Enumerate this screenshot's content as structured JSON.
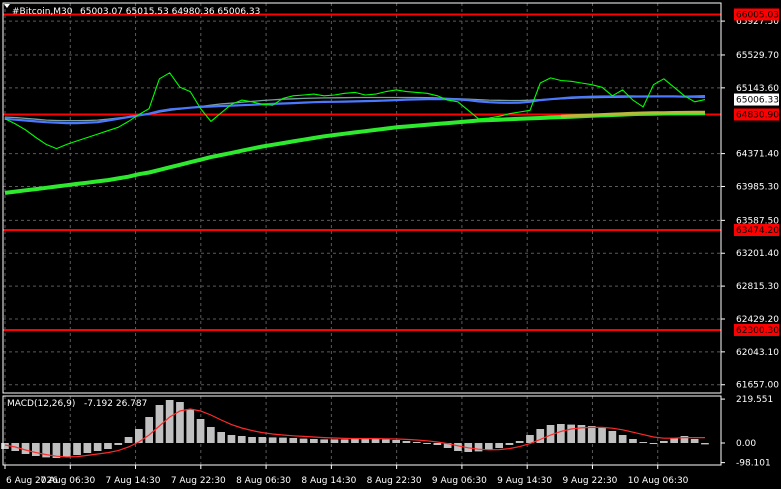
{
  "header": {
    "symbol_label": "#Bitcoin,M30",
    "quote": "65003.07 65015.53 64980.36 65006.33"
  },
  "macd": {
    "label": "MACD(12,26,9)",
    "values": "-7.192 26.787",
    "axis_ticks": [
      "219.551",
      "0.00",
      "-98.101"
    ]
  },
  "colors": {
    "background": "#000000",
    "grid": "#5a5a5a",
    "price": "#00ff00",
    "ma_fast": "#4a78ff",
    "ma_mid": "#7a9fa0",
    "ma_slow": "#2eea2e",
    "ma_olive": "#b8b83a",
    "level_line": "#ff0000",
    "histogram": "#c0c0c0",
    "signal": "#ff2a2a"
  },
  "chart_data": [
    {
      "type": "line",
      "title": "#Bitcoin,M30",
      "ylim": [
        61560,
        66140
      ],
      "y_ticks": [
        "65927.50",
        "65529.70",
        "65143.60",
        "64371.40",
        "63985.30",
        "63587.50",
        "63201.40",
        "62815.30",
        "62429.20",
        "62043.10",
        "61657.00"
      ],
      "x_ticks": [
        "6 Aug 2026",
        "7 Aug 06:30",
        "7 Aug 14:30",
        "7 Aug 22:30",
        "8 Aug 06:30",
        "8 Aug 14:30",
        "8 Aug 22:30",
        "9 Aug 06:30",
        "9 Aug 14:30",
        "9 Aug 22:30",
        "10 Aug 06:30"
      ],
      "last_price": "65006.33",
      "levels": [
        {
          "label": "66005.03",
          "value": 66005.03
        },
        {
          "label": "64830.90",
          "value": 64830.9
        },
        {
          "label": "63474.20",
          "value": 63474.2
        },
        {
          "label": "62300.30",
          "value": 62300.3
        }
      ],
      "series": [
        {
          "key": "price",
          "values": [
            64780,
            64720,
            64650,
            64560,
            64480,
            64430,
            64480,
            64520,
            64560,
            64600,
            64640,
            64680,
            64750,
            64830,
            64900,
            65250,
            65320,
            65150,
            65100,
            64900,
            64750,
            64850,
            64950,
            65000,
            64980,
            64950,
            64940,
            65020,
            65050,
            65060,
            65070,
            65050,
            65060,
            65080,
            65090,
            65060,
            65070,
            65100,
            65120,
            65100,
            65090,
            65080,
            65050,
            65000,
            64980,
            64880,
            64780,
            64790,
            64810,
            64840,
            64860,
            64880,
            65200,
            65260,
            65230,
            65220,
            65200,
            65180,
            65150,
            65050,
            65120,
            65000,
            64920,
            65180,
            65250,
            65150,
            65050,
            64980,
            65006
          ]
        },
        {
          "key": "ma_fast",
          "values": [
            64780,
            64770,
            64760,
            64750,
            64740,
            64735,
            64730,
            64730,
            64735,
            64740,
            64760,
            64780,
            64800,
            64820,
            64840,
            64870,
            64890,
            64900,
            64910,
            64920,
            64925,
            64930,
            64935,
            64940,
            64945,
            64950,
            64955,
            64960,
            64965,
            64970,
            64975,
            64978,
            64980,
            64982,
            64985,
            64988,
            64990,
            64995,
            65000,
            65005,
            65008,
            65010,
            65012,
            65010,
            65008,
            65000,
            64985,
            64975,
            64970,
            64968,
            64970,
            64980,
            65000,
            65010,
            65020,
            65030,
            65035,
            65040,
            65042,
            65042,
            65043,
            65043,
            65042,
            65043,
            65043,
            65043,
            65040,
            65038,
            65036
          ]
        },
        {
          "key": "ma_mid",
          "values": [
            64800,
            64795,
            64785,
            64775,
            64765,
            64760,
            64758,
            64758,
            64760,
            64765,
            64775,
            64790,
            64805,
            64820,
            64835,
            64860,
            64880,
            64895,
            64910,
            64925,
            64940,
            64955,
            64965,
            64975,
            64985,
            64995,
            65002,
            65010,
            65015,
            65020,
            65023,
            65025,
            65027,
            65028,
            65030,
            65030,
            65030,
            65030,
            65030,
            65030,
            65030,
            65028,
            65025,
            65020,
            65015,
            65010,
            65005,
            65000,
            64997,
            64995,
            64995,
            64998,
            65005,
            65010,
            65015,
            65020,
            65025,
            65028,
            65030,
            65032,
            65034,
            65036,
            65038,
            65040,
            65042,
            65044,
            65046,
            65048,
            65050
          ]
        },
        {
          "key": "ma_slow",
          "values": [
            63910,
            63925,
            63940,
            63955,
            63970,
            63985,
            64000,
            64015,
            64030,
            64045,
            64060,
            64080,
            64100,
            64130,
            64150,
            64180,
            64210,
            64240,
            64270,
            64300,
            64330,
            64355,
            64380,
            64405,
            64430,
            64455,
            64475,
            64495,
            64515,
            64535,
            64555,
            64575,
            64590,
            64605,
            64620,
            64635,
            64650,
            64665,
            64680,
            64690,
            64700,
            64710,
            64720,
            64730,
            64740,
            64750,
            64760,
            64765,
            64770,
            64775,
            64780,
            64785,
            64790,
            64795,
            64800,
            64805,
            64810,
            64815,
            64820,
            64825,
            64830,
            64835,
            64838,
            64840,
            64842,
            64844,
            64845,
            64846,
            64848
          ]
        },
        {
          "key": "ma_olive",
          "values": [
            null,
            null,
            null,
            null,
            null,
            null,
            null,
            null,
            null,
            null,
            null,
            null,
            null,
            null,
            null,
            null,
            null,
            null,
            null,
            null,
            null,
            null,
            null,
            null,
            null,
            null,
            null,
            null,
            null,
            null,
            null,
            null,
            null,
            null,
            null,
            null,
            null,
            null,
            null,
            null,
            null,
            null,
            null,
            null,
            null,
            null,
            null,
            null,
            null,
            null,
            null,
            null,
            null,
            null,
            64810,
            64815,
            64820,
            64825,
            64830,
            64835,
            64840,
            64845,
            64848,
            64850,
            64852,
            64854,
            64855,
            64856,
            64857
          ]
        }
      ]
    },
    {
      "type": "bar",
      "title": "MACD(12,26,9)",
      "ylim": [
        -110,
        235
      ],
      "histogram": [
        -30,
        -40,
        -55,
        -65,
        -72,
        -75,
        -70,
        -60,
        -50,
        -40,
        -30,
        -10,
        30,
        70,
        130,
        190,
        215,
        205,
        170,
        120,
        80,
        55,
        40,
        35,
        30,
        30,
        28,
        27,
        25,
        22,
        20,
        18,
        18,
        18,
        20,
        22,
        20,
        18,
        15,
        10,
        5,
        0,
        -10,
        -25,
        -40,
        -45,
        -42,
        -35,
        -25,
        -10,
        10,
        40,
        70,
        90,
        95,
        92,
        90,
        85,
        75,
        60,
        40,
        20,
        5,
        0,
        10,
        25,
        35,
        20,
        -7
      ],
      "signal": [
        -10,
        -20,
        -35,
        -48,
        -58,
        -66,
        -70,
        -68,
        -62,
        -55,
        -48,
        -38,
        -20,
        5,
        40,
        85,
        130,
        160,
        170,
        160,
        140,
        115,
        92,
        75,
        62,
        52,
        45,
        40,
        36,
        33,
        30,
        27,
        25,
        23,
        22,
        22,
        22,
        21,
        20,
        18,
        15,
        11,
        5,
        -3,
        -14,
        -24,
        -31,
        -34,
        -33,
        -28,
        -18,
        -3,
        18,
        40,
        58,
        70,
        76,
        78,
        78,
        74,
        66,
        54,
        42,
        30,
        24,
        24,
        27,
        27,
        27
      ]
    }
  ]
}
